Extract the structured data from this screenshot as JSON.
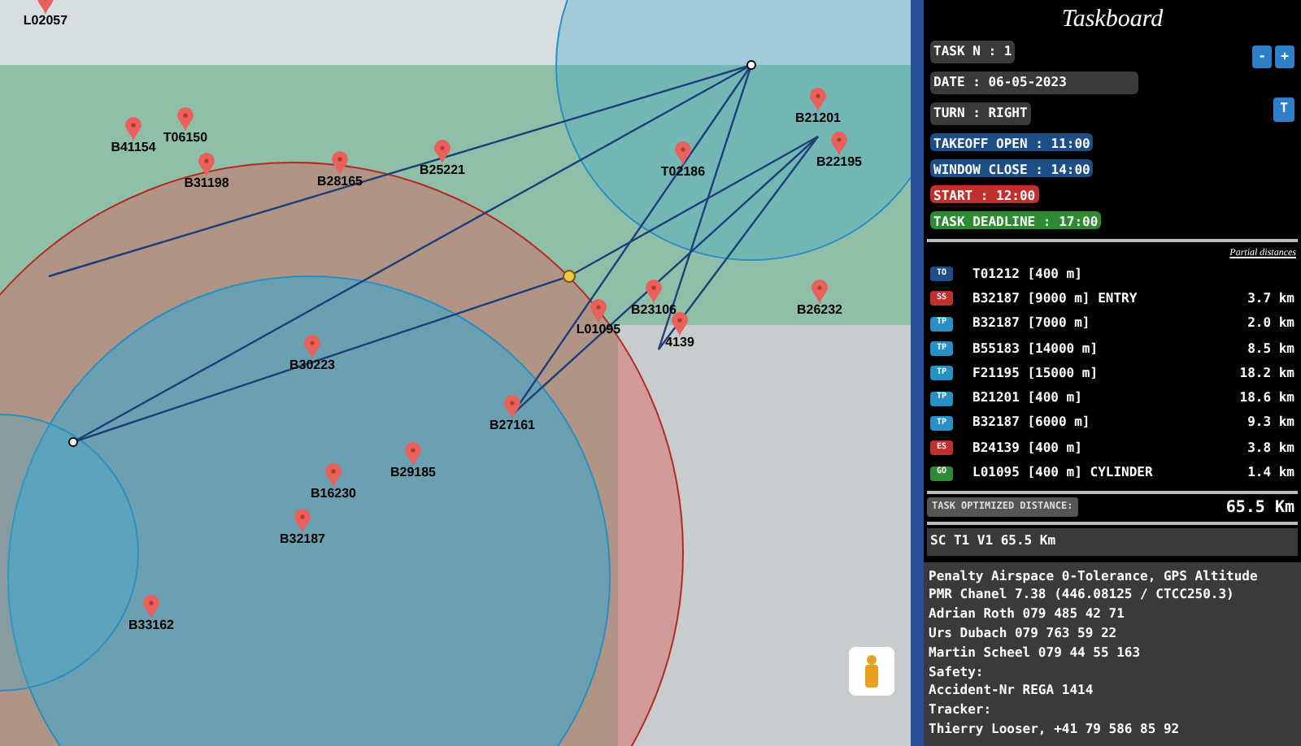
{
  "map": {
    "waypoints": [
      {
        "label": "L02057"
      },
      {
        "label": "T06150"
      },
      {
        "label": "B41154"
      },
      {
        "label": "B31198"
      },
      {
        "label": "B28165"
      },
      {
        "label": "B25221"
      },
      {
        "label": "T02186"
      },
      {
        "label": "B21201"
      },
      {
        "label": "B22195"
      },
      {
        "label": "B23106"
      },
      {
        "label": "B26232"
      },
      {
        "label": "L01095"
      },
      {
        "label": "4139"
      },
      {
        "label": "B30223"
      },
      {
        "label": "B27161"
      },
      {
        "label": "B29185"
      },
      {
        "label": "B16230"
      },
      {
        "label": "B32187"
      },
      {
        "label": "B33162"
      }
    ]
  },
  "taskboard": {
    "title": "Taskboard",
    "task_number": "TASK N : 1",
    "buttons": [
      "-",
      "+"
    ],
    "date": "DATE : 06-05-2023",
    "turn": "TURN : RIGHT",
    "turn_button": "T",
    "times": [
      {
        "text": "TAKEOFF OPEN : 11:00",
        "color": "#1d4f86"
      },
      {
        "text": "WINDOW CLOSE : 14:00",
        "color": "#1d4f86"
      },
      {
        "text": "START : 12:00",
        "color": "#c0302e"
      },
      {
        "text": "TASK DEADLINE : 17:00",
        "color": "#2f8a34"
      }
    ],
    "partial_distances_label": "Partial distances",
    "turnpoints": [
      {
        "type": "TO",
        "color": "#1d4f86",
        "name": "T01212 [400 m]"
      },
      {
        "type": "SS",
        "color": "#c0302e",
        "name": "B32187 [9000 m] ENTRY",
        "distance": "3.7 km"
      },
      {
        "type": "TP",
        "color": "#2a8fc4",
        "name": "B32187 [7000 m]",
        "distance": "2.0 km"
      },
      {
        "type": "TP",
        "color": "#2a8fc4",
        "name": "B55183 [14000 m]",
        "distance": "8.5 km"
      },
      {
        "type": "TP",
        "color": "#2a8fc4",
        "name": "F21195 [15000 m]",
        "distance": "18.2 km"
      },
      {
        "type": "TP",
        "color": "#2a8fc4",
        "name": "B21201 [400 m]",
        "distance": "18.6 km"
      },
      {
        "type": "TP",
        "color": "#2a8fc4",
        "name": "B32187 [6000 m]",
        "distance": "9.3 km"
      },
      {
        "type": "ES",
        "color": "#c0302e",
        "name": "B24139 [400 m]",
        "distance": "3.8 km"
      },
      {
        "type": "GO",
        "color": "#2f8a34",
        "name": "L01095 [400 m] CYLINDER",
        "distance": "1.4 km"
      }
    ],
    "optimized_distance_label": "TASK OPTIMIZED DISTANCE:",
    "optimized_distance": "65.5 Km",
    "comment": "SC T1 V1 65.5 Km",
    "notes": [
      "Penalty Airspace 0-Tolerance, GPS Altitude",
      "PMR Chanel 7.38 (446.08125 / CTCC250.3)",
      "Adrian Roth 079 485 42 71",
      "Urs Dubach 079 763 59 22",
      "Martin Scheel 079 44 55 163",
      "Safety:",
      "Accident-Nr REGA 1414",
      "Tracker:",
      "Thierry Looser, +41 79 586 85 92"
    ]
  }
}
